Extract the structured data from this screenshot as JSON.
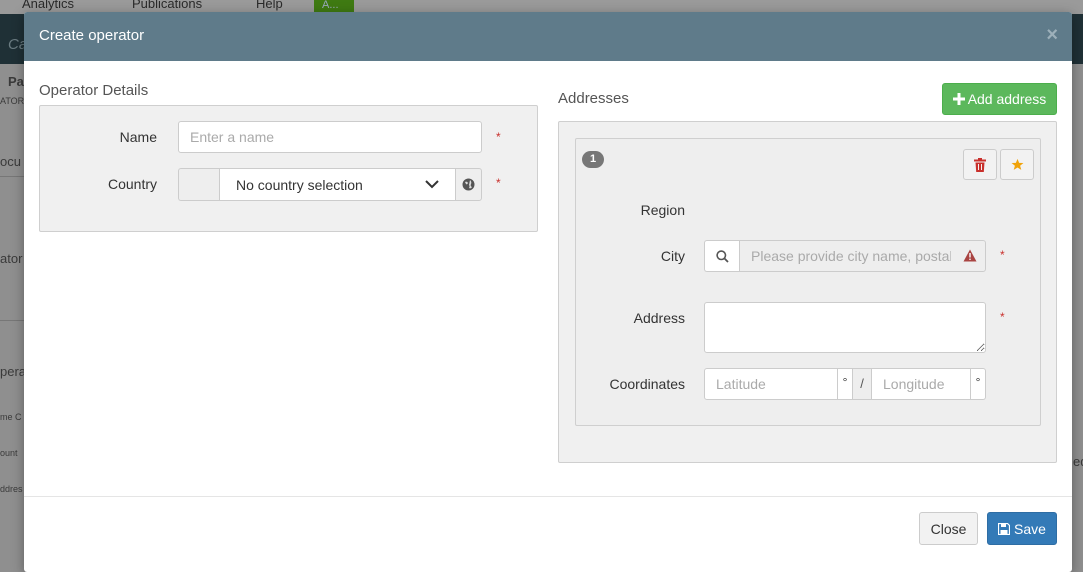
{
  "background": {
    "nav": [
      "Analytics",
      "Publications",
      "Help",
      "A..."
    ],
    "band_text": "Ca",
    "side_fragments": [
      "Pa",
      "ATOR",
      "ocu",
      "ator",
      "pera",
      "me C",
      "ount",
      "ddres"
    ],
    "right_fragments": [
      "ed"
    ]
  },
  "modal": {
    "title": "Create operator",
    "close_glyph": "×"
  },
  "operator_details": {
    "heading": "Operator Details",
    "name_label": "Name",
    "name_placeholder": "Enter a name",
    "name_value": "",
    "country_label": "Country",
    "country_selected": "No country selection",
    "required_mark": "*"
  },
  "addresses": {
    "heading": "Addresses",
    "add_button_label": "Add address",
    "items": [
      {
        "number": "1",
        "region_label": "Region",
        "city_label": "City",
        "city_placeholder": "Please provide city name, postal code",
        "city_value": "",
        "address_label": "Address",
        "address_value": "",
        "coordinates_label": "Coordinates",
        "latitude_placeholder": "Latitude",
        "longitude_placeholder": "Longitude",
        "degree_symbol": "°",
        "separator": "/"
      }
    ]
  },
  "footer": {
    "close_label": "Close",
    "save_label": "Save"
  },
  "colors": {
    "header_bg": "#5f7b8a",
    "success": "#5cb85c",
    "primary": "#337ab7",
    "danger": "#c9302c",
    "warning": "#f0a30a"
  },
  "icons": {
    "add": "plus-icon",
    "delete": "trash-icon",
    "primary_address": "star-icon",
    "search": "search-icon",
    "warning": "warning-triangle-icon",
    "globe": "globe-icon",
    "save": "floppy-disk-icon"
  }
}
